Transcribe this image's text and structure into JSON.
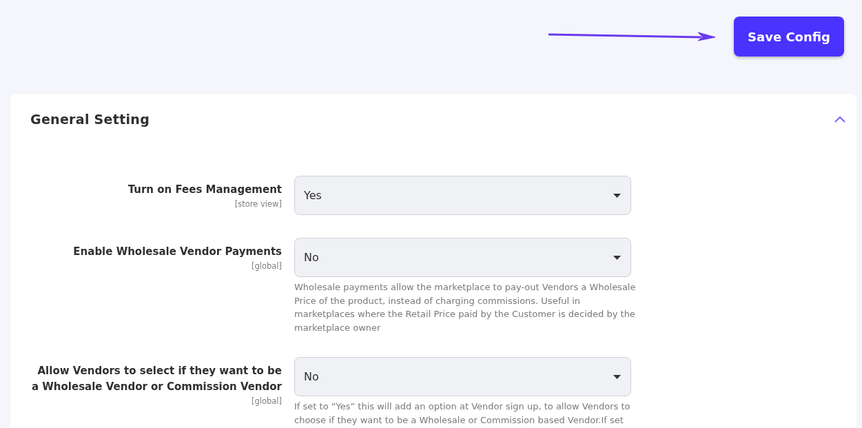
{
  "save_button": {
    "label": "Save Config"
  },
  "section": {
    "title": "General Setting",
    "expanded": true,
    "fields": [
      {
        "label": "Turn on Fees Management",
        "scope": "[store view]",
        "value": "Yes"
      },
      {
        "label": "Enable Wholesale Vendor Payments",
        "scope": "[global]",
        "value": "No",
        "note": "Wholesale payments allow the marketplace to pay-out Vendors a Wholesale Price of the product, instead of charging commissions. Useful in marketplaces where the Retail Price paid by the Customer is decided by the marketplace owner"
      },
      {
        "label": "Allow Vendors to select if they want to be a Wholesale Vendor or Commission Vendor",
        "scope": "[global]",
        "value": "No",
        "note": "If set to “Yes” this will add an option at Vendor sign up, to allow Vendors to choose if they want to be a Wholesale or Commission based Vendor.If set"
      }
    ]
  }
}
